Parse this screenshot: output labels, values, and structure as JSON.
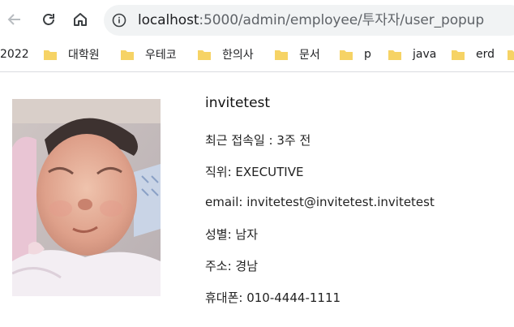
{
  "browser": {
    "url_host": "localhost",
    "url_path": ":5000/admin/employee/투자자/user_popup",
    "nav": {
      "back": "arrow-left-icon",
      "reload": "reload-icon",
      "home": "home-icon",
      "site_info": "info-icon"
    }
  },
  "bookmarks": [
    {
      "label": "2022",
      "icon": "none"
    },
    {
      "label": "대학원",
      "icon": "folder-icon"
    },
    {
      "label": "우테코",
      "icon": "folder-icon"
    },
    {
      "label": "한의사",
      "icon": "folder-icon"
    },
    {
      "label": "문서",
      "icon": "folder-icon"
    },
    {
      "label": "p",
      "icon": "folder-icon"
    },
    {
      "label": "java",
      "icon": "folder-icon"
    },
    {
      "label": "erd",
      "icon": "folder-icon"
    }
  ],
  "profile": {
    "name": "invitetest",
    "last_login": "최근 접속일 : 3주 전",
    "position": "직위: EXECUTIVE",
    "email": "email: invitetest@invitetest.invitetest",
    "gender": "성별: 남자",
    "address": "주소: 경남",
    "phone": "휴대폰: 010-4444-1111"
  },
  "colors": {
    "omnibox_bg": "#f1f3f4",
    "folder_yellow": "#f6d365",
    "text": "#202124"
  }
}
